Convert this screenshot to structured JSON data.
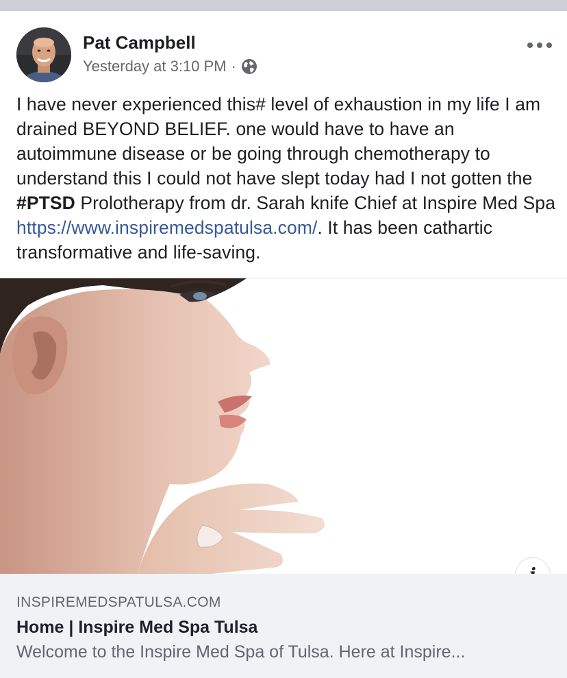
{
  "post": {
    "author": "Pat Campbell",
    "timestamp": "Yesterday at 3:10 PM",
    "separator": "·",
    "audience_icon": "globe-icon",
    "more_icon": "more-options-icon",
    "text": {
      "part1": "I have never experienced this# level of exhaustion in my life I am drained BEYOND BELIEF. one would have to have an autoimmune disease or be going through chemotherapy to understand this I could not have slept today had I not gotten the ",
      "hashtag": "#PTSD",
      "part2": " Prolotherapy from dr. Sarah knife Chief at Inspire Med Spa ",
      "link": "https://www.inspiremedspatulsa.com/",
      "part3": ". It has been cathartic transformative and life-saving."
    }
  },
  "link_preview": {
    "info_label": "i",
    "domain": "INSPIREMEDSPATULSA.COM",
    "title": "Home | Inspire Med Spa Tulsa",
    "description": "Welcome to the Inspire Med Spa of Tulsa. Here at Inspire..."
  },
  "colors": {
    "link": "#385898",
    "secondary_text": "#65676b",
    "footer_bg": "#f0f2f5",
    "top_strip": "#cdd0d6"
  }
}
